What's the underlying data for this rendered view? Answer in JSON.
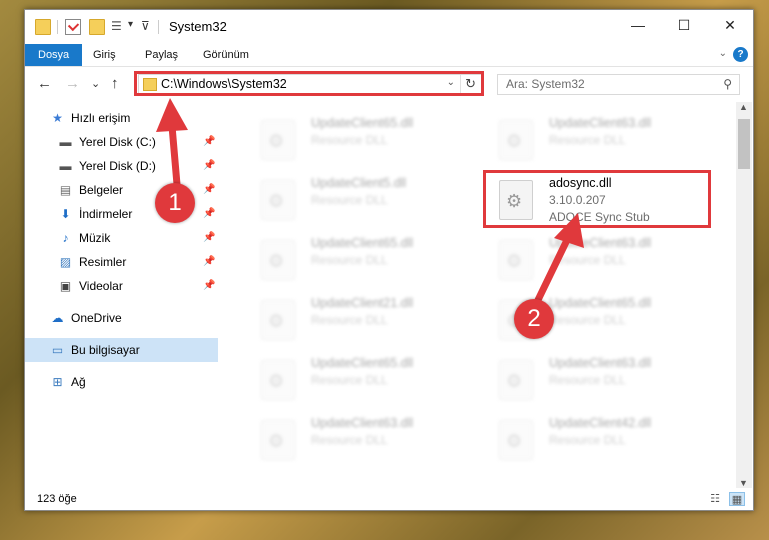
{
  "window": {
    "title": "System32",
    "controls": {
      "minimize": "—",
      "maximize": "☐",
      "close": "✕"
    }
  },
  "ribbon": {
    "tabs": [
      "Dosya",
      "Giriş",
      "Paylaş",
      "Görünüm"
    ]
  },
  "nav": {
    "back": "←",
    "forward": "→",
    "recent": "⌄",
    "up": "↑",
    "address": "C:\\Windows\\System32",
    "search_placeholder": "Ara: System32"
  },
  "sidebar": {
    "items": [
      {
        "label": "Hızlı erişim",
        "icon": "star-icon",
        "glyph": "★",
        "color": "#3a7bd5"
      },
      {
        "label": "Yerel Disk (C:)",
        "icon": "drive-icon",
        "glyph": "▬",
        "color": "#555555"
      },
      {
        "label": "Yerel Disk (D:)",
        "icon": "drive-icon",
        "glyph": "▬",
        "color": "#555555"
      },
      {
        "label": "Belgeler",
        "icon": "documents-icon",
        "glyph": "▤",
        "color": "#6a6a6a"
      },
      {
        "label": "İndirmeler",
        "icon": "download-icon",
        "glyph": "⬇",
        "color": "#1f6ec7"
      },
      {
        "label": "Müzik",
        "icon": "music-icon",
        "glyph": "♪",
        "color": "#1f6ec7"
      },
      {
        "label": "Resimler",
        "icon": "pictures-icon",
        "glyph": "▨",
        "color": "#3b7bbf"
      },
      {
        "label": "Videolar",
        "icon": "videos-icon",
        "glyph": "▣",
        "color": "#444444"
      },
      {
        "label": "OneDrive",
        "icon": "cloud-icon",
        "glyph": "☁",
        "color": "#1f6ec7"
      },
      {
        "label": "Bu bilgisayar",
        "icon": "computer-icon",
        "glyph": "▭",
        "color": "#3b7bbf"
      },
      {
        "label": "Ağ",
        "icon": "network-icon",
        "glyph": "⊞",
        "color": "#3b7bbf"
      }
    ],
    "pin_glyph": "📌"
  },
  "files": {
    "left": [
      {
        "name": "UpdateClient65.dll",
        "type": "Resource DLL"
      },
      {
        "name": "UpdateClient5.dll",
        "type": "Resource DLL"
      },
      {
        "name": "UpdateClient65.dll",
        "type": "Resource DLL"
      },
      {
        "name": "UpdateClient21.dll",
        "type": "Resource DLL"
      },
      {
        "name": "UpdateClient65.dll",
        "type": "Resource DLL"
      },
      {
        "name": "UpdateClient63.dll",
        "type": "Resource DLL"
      }
    ],
    "right": [
      {
        "name": "UpdateClient63.dll",
        "type": "Resource DLL"
      },
      {
        "name": "UpdateClient63.dll",
        "type": "Resource DLL"
      },
      {
        "name": "UpdateClient65.dll",
        "type": "Resource DLL"
      },
      {
        "name": "UpdateClient63.dll",
        "type": "Resource DLL"
      },
      {
        "name": "UpdateClient42.dll",
        "type": "Resource DLL"
      }
    ],
    "highlighted": {
      "name": "adosync.dll",
      "version": "3.10.0.207",
      "description": "ADOCE Sync Stub"
    }
  },
  "status": {
    "item_count": "123 öğe",
    "view_details": "☷",
    "view_tiles": "▦"
  },
  "annotations": {
    "badge1": "1",
    "badge2": "2",
    "color": "#e0393c"
  }
}
